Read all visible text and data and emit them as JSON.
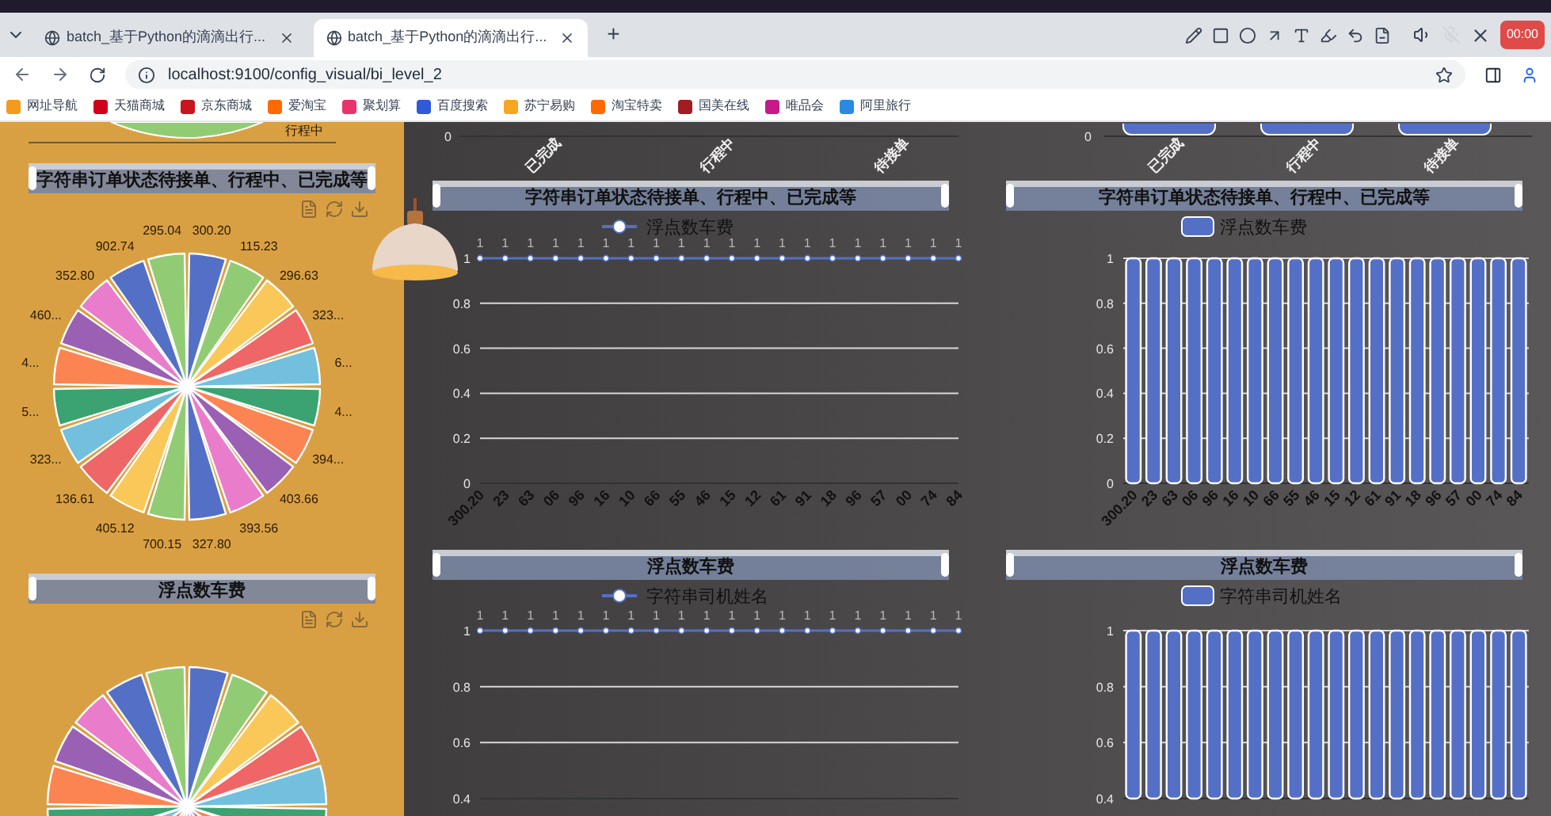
{
  "browser": {
    "tabs": [
      {
        "title": "batch_基于Python的滴滴出行...",
        "selected": false
      },
      {
        "title": "batch_基于Python的滴滴出行...",
        "selected": true
      }
    ],
    "new_tab": "+",
    "url": "localhost:9100/config_visual/bi_level_2",
    "recording": "00:00"
  },
  "bookmarks": [
    {
      "label": "网址导航",
      "color": "#f29b1d"
    },
    {
      "label": "天猫商城",
      "color": "#d0021b"
    },
    {
      "label": "京东商城",
      "color": "#c9151e"
    },
    {
      "label": "爱淘宝",
      "color": "#ff6a00"
    },
    {
      "label": "聚划算",
      "color": "#e8336d"
    },
    {
      "label": "百度搜索",
      "color": "#2f5bd8"
    },
    {
      "label": "苏宁易购",
      "color": "#f5a623"
    },
    {
      "label": "淘宝特卖",
      "color": "#ff6a00"
    },
    {
      "label": "国美在线",
      "color": "#a11d21"
    },
    {
      "label": "唯品会",
      "color": "#c51a8a"
    },
    {
      "label": "阿里旅行",
      "color": "#2a8ae0"
    }
  ],
  "left_panel": {
    "top_label": "行程中",
    "cards": [
      {
        "slider": {
          "title": "字符串订单状态待接单、行程中、已完成等",
          "level": 1
        },
        "pie_labels": [
          "300.20",
          "115.23",
          "296.63",
          "323...",
          "6...",
          "4...",
          "394...",
          "403.66",
          "393.56",
          "327.80",
          "700.15",
          "405.12",
          "136.61",
          "323...",
          "5...",
          "4...",
          "460...",
          "352.80",
          "902.74",
          "295.04"
        ]
      },
      {
        "slider": {
          "title": "浮点数车费",
          "level": 1
        }
      }
    ]
  },
  "columns": [
    {
      "top_strip": {
        "zero_tick": "0",
        "categories": [
          "已完成",
          "行程中",
          "待接单"
        ]
      },
      "slider": {
        "title": "字符串订单状态待接单、行程中、已完成等",
        "level": 1
      },
      "chart_data": {
        "type": "line",
        "categories": [
          "300.20",
          "23",
          "63",
          "06",
          "96",
          "16",
          "10",
          "66",
          "55",
          "46",
          "15",
          "12",
          "61",
          "91",
          "18",
          "96",
          "57",
          "00",
          "74",
          "84"
        ],
        "series": [
          {
            "name": "浮点数车费",
            "color": "#5470c6",
            "marker": "circle",
            "values": [
              1,
              1,
              1,
              1,
              1,
              1,
              1,
              1,
              1,
              1,
              1,
              1,
              1,
              1,
              1,
              1,
              1,
              1,
              1,
              1
            ]
          }
        ],
        "ylim": [
          0,
          1
        ],
        "yticks": [
          0,
          0.2,
          0.4,
          0.6,
          0.8,
          1
        ],
        "grid": true,
        "value_labels": [
          "1",
          "1",
          "1",
          "1",
          "1",
          "1",
          "1",
          "1",
          "1",
          "1",
          "1",
          "1",
          "1",
          "1",
          "1",
          "1",
          "1",
          "1",
          "1",
          "1"
        ]
      },
      "bottom": {
        "slider": {
          "title": "浮点数车费",
          "level": 1
        },
        "chart_data": {
          "type": "line",
          "series": [
            {
              "name": "字符串司机姓名",
              "color": "#5470c6",
              "marker": "circle",
              "values": [
                1,
                1,
                1,
                1,
                1,
                1,
                1,
                1,
                1,
                1,
                1,
                1,
                1,
                1,
                1,
                1,
                1,
                1,
                1,
                1
              ]
            }
          ],
          "ylim": [
            0.4,
            1
          ],
          "yticks": [
            0.4,
            0.6,
            0.8,
            1
          ],
          "grid": true,
          "value_labels": [
            "1",
            "1",
            "1",
            "1",
            "1",
            "1",
            "1",
            "1",
            "1",
            "1",
            "1",
            "1",
            "1",
            "1",
            "1",
            "1",
            "1",
            "1",
            "1",
            "1"
          ]
        }
      }
    },
    {
      "top_strip": {
        "zero_tick": "0",
        "categories": [
          "已完成",
          "行程中",
          "待接单"
        ]
      },
      "slider": {
        "title": "字符串订单状态待接单、行程中、已完成等",
        "level": 1
      },
      "chart_data": {
        "type": "bar",
        "categories": [
          "300.20",
          "23",
          "63",
          "06",
          "96",
          "16",
          "10",
          "66",
          "55",
          "46",
          "15",
          "12",
          "61",
          "91",
          "18",
          "96",
          "57",
          "00",
          "74",
          "84"
        ],
        "series": [
          {
            "name": "浮点数车费",
            "color": "#5470c6",
            "values": [
              1,
              1,
              1,
              1,
              1,
              1,
              1,
              1,
              1,
              1,
              1,
              1,
              1,
              1,
              1,
              1,
              1,
              1,
              1,
              1
            ]
          }
        ],
        "ylim": [
          0,
          1
        ],
        "yticks": [
          0,
          0.2,
          0.4,
          0.6,
          0.8,
          1
        ],
        "grid": true
      },
      "bottom": {
        "slider": {
          "title": "浮点数车费",
          "level": 1
        },
        "chart_data": {
          "type": "bar",
          "series": [
            {
              "name": "字符串司机姓名",
              "color": "#5470c6",
              "values": [
                1,
                1,
                1,
                1,
                1,
                1,
                1,
                1,
                1,
                1,
                1,
                1,
                1,
                1,
                1,
                1,
                1,
                1,
                1,
                1
              ]
            }
          ],
          "ylim": [
            0.4,
            1
          ],
          "yticks": [
            0.4,
            0.6,
            0.8,
            1
          ],
          "grid": true
        }
      }
    }
  ]
}
